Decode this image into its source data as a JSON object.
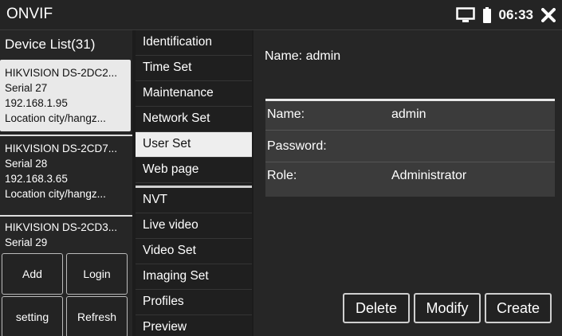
{
  "topbar": {
    "title": "ONVIF",
    "time": "06:33",
    "icons": [
      "monitor-icon",
      "battery-icon",
      "close-icon"
    ]
  },
  "device_list": {
    "header": "Device List(31)",
    "devices": [
      {
        "name": "HIKVISION DS-2DC2...",
        "serial": "Serial  27",
        "ip": "192.168.1.95",
        "location": "Location  city/hangz..."
      },
      {
        "name": "HIKVISION DS-2CD7...",
        "serial": "Serial  28",
        "ip": "192.168.3.65",
        "location": "Location  city/hangz..."
      },
      {
        "name": "HIKVISION DS-2CD3...",
        "serial": "Serial  29"
      }
    ],
    "buttons": {
      "add": "Add",
      "login": "Login",
      "setting": "setting",
      "refresh": "Refresh"
    }
  },
  "menu": {
    "items": [
      "Identification",
      "Time Set",
      "Maintenance",
      "Network Set",
      "User Set",
      "Web page",
      "NVT",
      "Live video",
      "Video Set",
      "Imaging Set",
      "Profiles",
      "Preview"
    ],
    "active": "User Set"
  },
  "user_panel": {
    "current_user": "Name: admin",
    "table": {
      "name_label": "Name:",
      "name_value": "admin",
      "password_label": "Password:",
      "password_value": "",
      "role_label": "Role:",
      "role_value": "Administrator"
    },
    "buttons": {
      "delete": "Delete",
      "modify": "Modify",
      "create": "Create"
    }
  },
  "colors": {
    "selected_bg": "#e9e9e9",
    "panel_bg": "#262626",
    "table_bg": "#3b3b3b"
  }
}
